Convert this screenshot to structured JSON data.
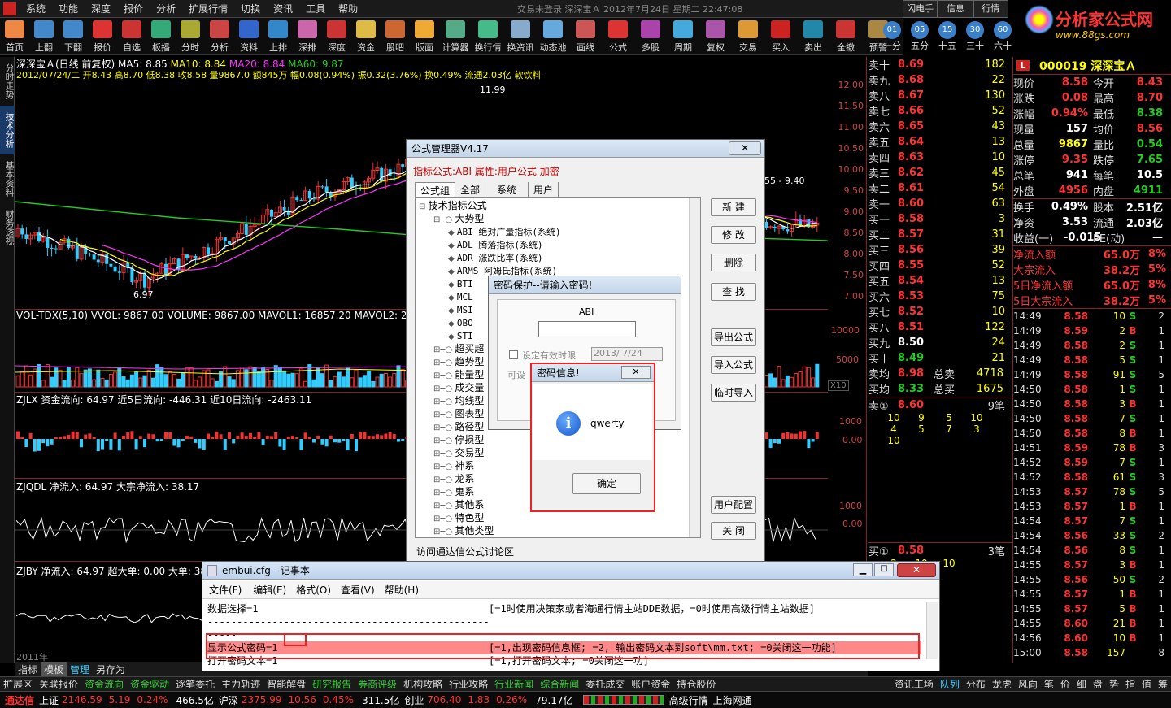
{
  "menubar": {
    "items": [
      "系统",
      "功能",
      "深度",
      "报价",
      "分析",
      "扩展行情",
      "切换",
      "资讯",
      "工具",
      "帮助"
    ],
    "title": "交易未登录 深深宝Ａ 2012年7月24日 星期二 22:47:08"
  },
  "toolbar": {
    "items": [
      "首页",
      "上翻",
      "下翻",
      "报价",
      "自选",
      "板播",
      "分时",
      "分析",
      "资料",
      "上排",
      "深排",
      "深度",
      "资金",
      "股吧",
      "版面",
      "计算器",
      "换行情",
      "换资讯",
      "动态池",
      "画线",
      "公式",
      "多股",
      "周期",
      "复权",
      "交易",
      "买入",
      "卖出",
      "全撤",
      "预警"
    ]
  },
  "right_buttons": [
    "闪电手",
    "信息",
    "行情"
  ],
  "periods": [
    {
      "n": "01",
      "l": "一分"
    },
    {
      "n": "05",
      "l": "五分"
    },
    {
      "n": "15",
      "l": "十五"
    },
    {
      "n": "30",
      "l": "三十"
    },
    {
      "n": "60",
      "l": "六十"
    }
  ],
  "logo": {
    "text": "分析家公式网",
    "url": "www.88gs.com"
  },
  "vtabs": [
    "分时走势",
    "技术分析",
    "基本资料",
    "财务透视"
  ],
  "chart": {
    "title_line": "深深宝Ａ(日线 前复权) MA5: 8.85 MA10: 8.84 MA20: 8.84 MA60: 9.87",
    "ma5": "MA5: 8.85",
    "ma10": "MA10: 8.84",
    "ma20": "MA20: 8.84",
    "ma60": "MA60: 9.87",
    "info_line": "2012/07/24/二 开8.43 高8.70 低8.38 收8.58 量9867.0 额845万 幅0.08(0.94%) 振0.32(3.76%) 换0.49% 流通2.03亿 软饮料",
    "high_label": "11.99",
    "low_label": "6.97",
    "range_label": "55 - 9.40",
    "price_axis": [
      "12.00",
      "11.50",
      "11.00",
      "10.50",
      "10.00",
      "9.50",
      "9.00",
      "8.50",
      "8.00",
      "7.50",
      "7.00"
    ],
    "vol_title": "VOL-TDX(5,10) VVOL: 9867.00 VOLUME: 9867.00 MAVOL1: 16857.20 MAVOL2: 24119",
    "vol_axis": [
      "10000",
      "5000"
    ],
    "vol_unit": "X10",
    "zjlx_title": "ZJLX 资金流向: 64.97  近5日流向: -446.31  近10日流向: -2463.11",
    "zjlx_axis": [
      "1000",
      "0.00"
    ],
    "zjqdl_title": "ZJQDL 净流入: 64.97 大宗净流入: 38.17",
    "zjqdl_axis": [
      "1000",
      "0.00"
    ],
    "zjby_title": "ZJBY 净流入: 64.97 超大单: 0.00 大单: 38",
    "year_label": "2011年",
    "bottom_tabs": [
      "指标",
      "模板",
      "管理",
      "另存为"
    ]
  },
  "book": {
    "asks": [
      {
        "l": "卖十",
        "p": "8.69",
        "v": "182"
      },
      {
        "l": "卖九",
        "p": "8.68",
        "v": "22"
      },
      {
        "l": "卖八",
        "p": "8.67",
        "v": "130"
      },
      {
        "l": "卖七",
        "p": "8.66",
        "v": "52"
      },
      {
        "l": "卖六",
        "p": "8.65",
        "v": "43"
      },
      {
        "l": "卖五",
        "p": "8.64",
        "v": "13"
      },
      {
        "l": "卖四",
        "p": "8.63",
        "v": "10"
      },
      {
        "l": "卖三",
        "p": "8.62",
        "v": "45"
      },
      {
        "l": "卖二",
        "p": "8.61",
        "v": "54"
      },
      {
        "l": "卖一",
        "p": "8.60",
        "v": "63"
      }
    ],
    "bids": [
      {
        "l": "买一",
        "p": "8.58",
        "v": "3"
      },
      {
        "l": "买二",
        "p": "8.57",
        "v": "31"
      },
      {
        "l": "买三",
        "p": "8.56",
        "v": "39"
      },
      {
        "l": "买四",
        "p": "8.55",
        "v": "52"
      },
      {
        "l": "买五",
        "p": "8.54",
        "v": "13"
      },
      {
        "l": "买六",
        "p": "8.53",
        "v": "75"
      },
      {
        "l": "买七",
        "p": "8.52",
        "v": "10"
      },
      {
        "l": "买八",
        "p": "8.51",
        "v": "122"
      },
      {
        "l": "买九",
        "p": "8.50",
        "v": "24"
      },
      {
        "l": "买十",
        "p": "8.49",
        "v": "21"
      }
    ],
    "avg_sell": {
      "l": "卖均",
      "p": "8.98",
      "k": "总卖",
      "v": "4718"
    },
    "avg_buy": {
      "l": "买均",
      "p": "8.33",
      "k": "总买",
      "v": "1675"
    },
    "sell1": {
      "l": "卖①",
      "p": "8.60",
      "v": "9笔"
    },
    "sell1_queue": [
      "10",
      "9",
      "5",
      "10",
      "4",
      "5",
      "7",
      "3",
      "10"
    ],
    "buy1": {
      "l": "买①",
      "p": "8.58",
      "v": "3笔"
    },
    "buy1_queue": [
      "2",
      "10",
      "10"
    ]
  },
  "quote": {
    "code": "000019 深深宝Ａ",
    "rows": [
      [
        "现价",
        "8.58",
        "今开",
        "8.43"
      ],
      [
        "涨跌",
        "0.08",
        "最高",
        "8.70"
      ],
      [
        "涨幅",
        "0.94%",
        "最低",
        "8.38"
      ],
      [
        "现量",
        "157",
        "均价",
        "8.56"
      ],
      [
        "总量",
        "9867",
        "量比",
        "0.54"
      ],
      [
        "涨停",
        "9.35",
        "跌停",
        "7.65"
      ],
      [
        "总笔",
        "941",
        "每笔",
        "10.5"
      ],
      [
        "外盘",
        "4956",
        "内盘",
        "4911"
      ]
    ],
    "rows2": [
      [
        "换手",
        "0.49%",
        "股本",
        "2.51亿"
      ],
      [
        "净资",
        "3.53",
        "流通",
        "2.03亿"
      ],
      [
        "收益(一)",
        "-0.015",
        "PE(动)",
        "—"
      ]
    ],
    "flow": [
      [
        "净流入额",
        "65.0万",
        "8%"
      ],
      [
        "大宗流入",
        "38.2万",
        "5%"
      ],
      [
        "5日净流入额",
        "65.0万",
        "8%"
      ],
      [
        "5日大宗流入",
        "38.2万",
        "5%"
      ]
    ],
    "ticks": [
      [
        "14:49",
        "8.58",
        "10",
        "S",
        "2"
      ],
      [
        "14:49",
        "8.59",
        "2",
        "B",
        "1"
      ],
      [
        "14:49",
        "8.58",
        "2",
        "S",
        "1"
      ],
      [
        "14:49",
        "8.58",
        "5",
        "S",
        "1"
      ],
      [
        "14:49",
        "8.58",
        "91",
        "S",
        "5"
      ],
      [
        "14:50",
        "8.58",
        "1",
        "S",
        "1"
      ],
      [
        "14:50",
        "8.58",
        "3",
        "B",
        "1"
      ],
      [
        "14:50",
        "8.58",
        "7",
        "S",
        "1"
      ],
      [
        "14:50",
        "8.58",
        "8",
        "B",
        "1"
      ],
      [
        "14:51",
        "8.59",
        "78",
        "B",
        "3"
      ],
      [
        "14:52",
        "8.59",
        "7",
        "S",
        "1"
      ],
      [
        "14:52",
        "8.58",
        "61",
        "S",
        "3"
      ],
      [
        "14:53",
        "8.57",
        "78",
        "S",
        "5"
      ],
      [
        "14:53",
        "8.57",
        "1",
        "B",
        "1"
      ],
      [
        "14:54",
        "8.57",
        "7",
        "S",
        "1"
      ],
      [
        "14:54",
        "8.56",
        "33",
        "S",
        "2"
      ],
      [
        "14:54",
        "8.56",
        "8",
        "S",
        "1"
      ],
      [
        "14:55",
        "8.57",
        "3",
        "B",
        "1"
      ],
      [
        "14:55",
        "8.56",
        "50",
        "S",
        "2"
      ],
      [
        "14:55",
        "8.57",
        "1",
        "B",
        "1"
      ],
      [
        "14:55",
        "8.57",
        "5",
        "B",
        "1"
      ],
      [
        "14:55",
        "8.60",
        "21",
        "B",
        "1"
      ],
      [
        "14:56",
        "8.60",
        "10",
        "B",
        "1"
      ],
      [
        "15:00",
        "8.58",
        "157",
        "",
        "8"
      ]
    ]
  },
  "formula_mgr": {
    "title": "公式管理器V4.17",
    "current": "指标公式:ABI 属性:用户公式 加密",
    "tabs": [
      "公式组",
      "全部",
      "系统",
      "用户"
    ],
    "tree": [
      {
        "d": 0,
        "t": "技术指标公式"
      },
      {
        "d": 1,
        "t": "大势型"
      },
      {
        "d": 2,
        "t": "ABI 绝对广量指标(系统)"
      },
      {
        "d": 2,
        "t": "ADL  腾落指标(系统)"
      },
      {
        "d": 2,
        "t": "ADR  涨跌比率(系统)"
      },
      {
        "d": 2,
        "t": "ARMS 阿姆氏指标(系统)"
      },
      {
        "d": 2,
        "t": "BTI"
      },
      {
        "d": 2,
        "t": "MCL"
      },
      {
        "d": 2,
        "t": "MSI"
      },
      {
        "d": 2,
        "t": "OBO"
      },
      {
        "d": 2,
        "t": "STI"
      },
      {
        "d": 1,
        "t": "超买超"
      },
      {
        "d": 1,
        "t": "趋势型"
      },
      {
        "d": 1,
        "t": "能量型"
      },
      {
        "d": 1,
        "t": "成交量"
      },
      {
        "d": 1,
        "t": "均线型"
      },
      {
        "d": 1,
        "t": "图表型"
      },
      {
        "d": 1,
        "t": "路径型"
      },
      {
        "d": 1,
        "t": "停损型"
      },
      {
        "d": 1,
        "t": "交易型"
      },
      {
        "d": 1,
        "t": "神系"
      },
      {
        "d": 1,
        "t": "龙系"
      },
      {
        "d": 1,
        "t": "鬼系"
      },
      {
        "d": 1,
        "t": "其他系"
      },
      {
        "d": 1,
        "t": "特色型"
      },
      {
        "d": 1,
        "t": "其他类型"
      }
    ],
    "buttons": [
      "新 建",
      "修 改",
      "删除",
      "查 找",
      "导出公式",
      "导入公式",
      "临时导入",
      "用户配置",
      "关 闭"
    ],
    "footer": "访问通达信公式讨论区"
  },
  "pwd_dialog": {
    "title": "密码保护--请输入密码!",
    "label": "ABI",
    "value": "",
    "checkbox": "设定有效时限",
    "date": "2013/ 7/24",
    "hint": "可设"
  },
  "msg_dialog": {
    "title": "密码信息!",
    "message": "qwerty",
    "ok": "确定",
    "close": "✕"
  },
  "notepad": {
    "title": "embui.cfg - 记事本",
    "menu": [
      "文件(F)",
      "编辑(E)",
      "格式(O)",
      "查看(V)",
      "帮助(H)"
    ],
    "lines": [
      {
        "l": "数据选择=1",
        "r": "[=1时使用决策家或者海通行情主站DDE数据，=0时使用高级行情主站数据]"
      },
      {
        "l": "-----------------------------------------------------------------------------------",
        "r": ""
      },
      {
        "l": "-----",
        "r": ""
      },
      {
        "l": "显示公式密码=1",
        "r": "[=1,出现密码信息框; =2, 输出密码文本到soft\\mm.txt; =0关闭这一功能]"
      },
      {
        "l": "打开密码文本=1",
        "r": "[=1,打开密码文本; =0关闭这一功]"
      }
    ]
  },
  "func_tabs": [
    "扩展区",
    "关联报价",
    "资金流向",
    "资金驱动",
    "逐笔委托",
    "主力轨迹",
    "智能解盘",
    "研究报告",
    "券商评级",
    "机构攻略",
    "行业攻略",
    "行业新闻",
    "综合新闻",
    "委托成交",
    "账户资金",
    "持仓股份"
  ],
  "func_right": [
    "资讯工场",
    "队列",
    "分布",
    "龙虎",
    "风向",
    "笔",
    "价",
    "细",
    "盘",
    "势",
    "指",
    "值",
    "筹"
  ],
  "status": {
    "brand": "通达信",
    "idx1": [
      "上证",
      "2146.59",
      "5.19",
      "0.24%",
      "466.5亿"
    ],
    "idx2": [
      "沪深",
      "2375.99",
      "10.56",
      "0.45%",
      "311.5亿"
    ],
    "idx3": [
      "创业",
      "706.40",
      "1.83",
      "0.26%",
      "79.17亿"
    ],
    "server": "高级行情_上海网通"
  }
}
